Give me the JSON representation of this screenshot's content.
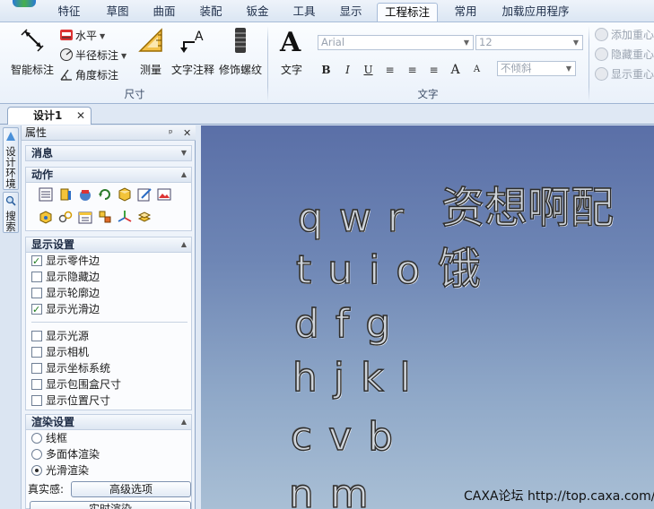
{
  "ribbon_tabs": [
    "特征",
    "草图",
    "曲面",
    "装配",
    "钣金",
    "工具",
    "显示",
    "工程标注",
    "常用",
    "加载应用程序"
  ],
  "active_tab": "工程标注",
  "groups": {
    "dimension": {
      "label": "尺寸",
      "smart_dim": "智能标注",
      "horizontal": "水平",
      "radius": "半径标注",
      "angle": "角度标注",
      "measure": "测量",
      "text_annotation": "文字注释",
      "thread": "修饰螺纹"
    },
    "text": {
      "label": "文字",
      "text_btn": "文字",
      "font_value": "Arial",
      "size_value": "12",
      "slant_value": "不倾斜",
      "format_buttons": [
        "B",
        "I",
        "U",
        "≡",
        "≡",
        "≡",
        "A",
        "A"
      ]
    },
    "centroid": {
      "add": "添加重心",
      "hide": "隐藏重心",
      "show": "显示重心"
    }
  },
  "doc_tab": "设计1",
  "side_tabs": {
    "design_env": "设计环境",
    "search": "搜索"
  },
  "panel": {
    "title": "属性",
    "message_section": "消息",
    "action_section": "动作",
    "display_section": "显示设置",
    "display_items": [
      {
        "label": "显示零件边",
        "checked": true
      },
      {
        "label": "显示隐藏边",
        "checked": false
      },
      {
        "label": "显示轮廓边",
        "checked": false
      },
      {
        "label": "显示光滑边",
        "checked": true
      },
      {
        "label": "显示光源",
        "checked": false
      },
      {
        "label": "显示相机",
        "checked": false
      },
      {
        "label": "显示坐标系统",
        "checked": false
      },
      {
        "label": "显示包围盒尺寸",
        "checked": false
      },
      {
        "label": "显示位置尺寸",
        "checked": false
      }
    ],
    "render_section": "渲染设置",
    "render_modes": [
      {
        "label": "线框",
        "selected": false
      },
      {
        "label": "多面体渲染",
        "selected": false
      },
      {
        "label": "光滑渲染",
        "selected": true
      }
    ],
    "realism_label": "真实感:",
    "advanced_button": "高级选项",
    "bottom_button": "实时渲染"
  },
  "viewport": {
    "text_rows": [
      "q w r",
      "t u i o",
      "d f g",
      "h j k l",
      "c v b",
      "n m"
    ],
    "cjk_line1": "资想啊配",
    "cjk_line2": "饿",
    "watermark": "CAXA论坛 http://top.caxa.com/"
  }
}
